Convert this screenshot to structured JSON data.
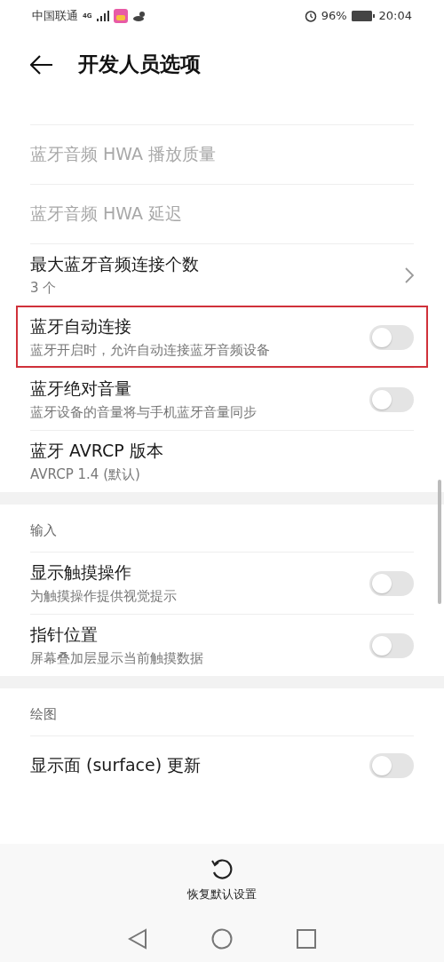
{
  "status_bar": {
    "carrier": "中国联通",
    "network": "4G",
    "battery": "96%",
    "time": "20:04"
  },
  "header": {
    "title": "开发人员选项"
  },
  "sections": [
    {
      "items": [
        {
          "kind": "plain",
          "title": "蓝牙音频 HWA 播放质量",
          "disabled": true
        },
        {
          "kind": "plain",
          "title": "蓝牙音频 HWA 延迟",
          "disabled": true
        },
        {
          "kind": "link",
          "title": "最大蓝牙音频连接个数",
          "subtitle": "3 个",
          "disabled": false
        },
        {
          "kind": "switch",
          "title": "蓝牙自动连接",
          "subtitle": "蓝牙开启时，允许自动连接蓝牙音频设备",
          "on": false,
          "disabled": false,
          "highlighted": true
        },
        {
          "kind": "switch",
          "title": "蓝牙绝对音量",
          "subtitle": "蓝牙设备的音量将与手机蓝牙音量同步",
          "on": false,
          "disabled": false
        },
        {
          "kind": "plain",
          "title": "蓝牙 AVRCP 版本",
          "subtitle": "AVRCP 1.4 (默认)",
          "disabled": false
        }
      ]
    },
    {
      "header": "输入",
      "items": [
        {
          "kind": "switch",
          "title": "显示触摸操作",
          "subtitle": "为触摸操作提供视觉提示",
          "on": false,
          "disabled": false
        },
        {
          "kind": "switch",
          "title": "指针位置",
          "subtitle": "屏幕叠加层显示当前触摸数据",
          "on": false,
          "disabled": false
        }
      ]
    },
    {
      "header": "绘图",
      "items": [
        {
          "kind": "switch",
          "title": "显示面 (surface) 更新",
          "on": false,
          "disabled": false
        }
      ]
    }
  ],
  "reset_button": {
    "label": "恢复默认设置"
  }
}
